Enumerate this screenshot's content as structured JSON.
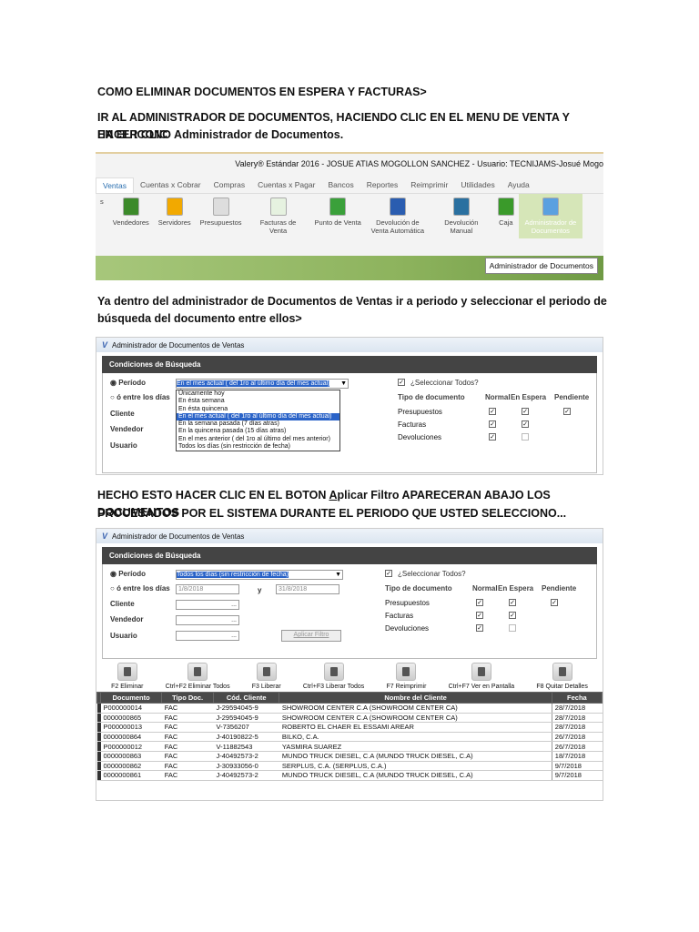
{
  "text": {
    "heading": "COMO ELIMINAR DOCUMENTOS EN ESPERA Y FACTURAS>",
    "step1_line1": "IR AL ADMINISTRADOR DE DOCUMENTOS, HACIENDO CLIC EN EL MENU DE VENTA Y HACER CLIC",
    "step1_line2": "EN EL ICONO Administrador de Documentos.",
    "step2_line1": "Ya dentro del administrador de Documentos de Ventas ir a periodo y seleccionar el periodo de",
    "step2_line2": "búsqueda del documento entre ellos>",
    "step3_line1_a": "HECHO ESTO HACER CLIC EN EL BOTON ",
    "step3_line1_u": "A",
    "step3_line1_b": "plicar Filtro APARECERAN ABAJO LOS DOCUMENTOS",
    "step3_line2": "PROCESADOS POR EL SISTEMA DURANTE EL PERIODO QUE USTED SELECCIONO..."
  },
  "app": {
    "title": "Valery® Estándar 2016 - JOSUE ATIAS MOGOLLON SANCHEZ - Usuario: TECNIJAMS-Josué Mogo",
    "tabs": [
      "Ventas",
      "Cuentas x Cobrar",
      "Compras",
      "Cuentas x Pagar",
      "Bancos",
      "Reportes",
      "Reimprimir",
      "Utilidades",
      "Ayuda"
    ],
    "ribbon": [
      {
        "label": "s",
        "color": "#fff"
      },
      {
        "label": "Vendedores",
        "color": "#3c8a2a"
      },
      {
        "label": "Servidores",
        "color": "#f2a900"
      },
      {
        "label": "Presupuestos",
        "color": "#ddd"
      },
      {
        "label": "Facturas de Venta",
        "color": "#e6f2e0"
      },
      {
        "label": "Punto de Venta",
        "color": "#3aa03a"
      },
      {
        "label": "Devolución de Venta Automática",
        "color": "#2a5db0"
      },
      {
        "label": "Devolución Manual",
        "color": "#2a70a0"
      },
      {
        "label": "Caja",
        "color": "#3a9a2a"
      },
      {
        "label": "Administrador de Documentos",
        "color": "#5aa0e0"
      }
    ],
    "tooltip": "Administrador de Documentos"
  },
  "admin": {
    "window_title": "Administrador de Documentos de Ventas",
    "section": "Condiciones de Búsqueda",
    "periodo": "Período",
    "entre": "ó entre los días",
    "cliente": "Cliente",
    "vendedor": "Vendedor",
    "usuario": "Usuario",
    "y": "y",
    "seleccionar_todos": "¿Seleccionar Todos?",
    "tipo_doc": "Tipo de documento",
    "normal": "Normal",
    "en_espera": "En Espera",
    "pendiente": "Pendiente",
    "presupuestos": "Presupuestos",
    "facturas": "Facturas",
    "devoluciones": "Devoluciones",
    "period_selected_1": "En el mes actual ( del 1ro al último día del mes actual)",
    "period_options": [
      "Únicamente hoy",
      "En ésta semana",
      "En ésta quincena",
      "En el mes actual ( del 1ro al último día del mes actual)",
      "En la semana pasada (7 días atras)",
      "En la quincena pasada (15 días atras)",
      "En el mes anterior ( del 1ro al último del mes anterior)",
      "Todos los días (sin restricción de fecha)"
    ],
    "period_selected_2": "Todos los días (sin restricción de fecha)",
    "date_from": "1/8/2018",
    "date_to": "31/8/2018",
    "ellipsis": "...",
    "aplicar": "Aplicar Filtro",
    "dropdown_arrow": "▼",
    "check": "✓"
  },
  "toolbar": [
    "F2 Eliminar",
    "Ctrl+F2 Eliminar Todos",
    "F3 Liberar",
    "Ctrl+F3 Liberar Todos",
    "F7 Reimprimir",
    "Ctrl+F7 Ver en Pantalla",
    "F8 Quitar Detalles"
  ],
  "table": {
    "headers": [
      "Documento",
      "Tipo Doc.",
      "Cód. Cliente",
      "Nombre del Cliente",
      "Fecha"
    ],
    "rows": [
      [
        "P000000014",
        "FAC",
        "J-29594045-9",
        "SHOWROOM CENTER C.A (SHOWROOM CENTER CA)",
        "28/7/2018"
      ],
      [
        "0000000865",
        "FAC",
        "J-29594045-9",
        "SHOWROOM CENTER C.A (SHOWROOM CENTER CA)",
        "28/7/2018"
      ],
      [
        "P000000013",
        "FAC",
        "V-7356207",
        "ROBERTO EL CHAER EL ESSAMI AREAR",
        "28/7/2018"
      ],
      [
        "0000000864",
        "FAC",
        "J-40190822-5",
        "BILKO,  C.A.",
        "26/7/2018"
      ],
      [
        "P000000012",
        "FAC",
        "V-11882543",
        "YASMIRA SUAREZ",
        "26/7/2018"
      ],
      [
        "0000000863",
        "FAC",
        "J-40492573-2",
        "MUNDO TRUCK DIESEL, C.A (MUNDO TRUCK DIESEL, C.A)",
        "18/7/2018"
      ],
      [
        "0000000862",
        "FAC",
        "J-30933056-0",
        "SERPLUS, C.A. (SERPLUS, C.A.)",
        "9/7/2018"
      ],
      [
        "0000000861",
        "FAC",
        "J-40492573-2",
        "MUNDO TRUCK DIESEL, C.A (MUNDO TRUCK DIESEL, C.A)",
        "9/7/2018"
      ]
    ]
  }
}
